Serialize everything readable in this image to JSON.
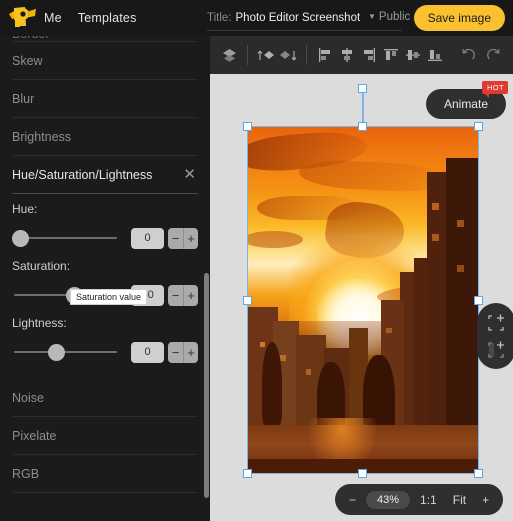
{
  "header": {
    "logo_icon": "logo-p-icon",
    "nav": [
      {
        "label": "Me"
      },
      {
        "label": "Templates"
      }
    ],
    "title_label": "Title:",
    "title_value": "Photo Editor Screenshot",
    "privacy_caret": "▼",
    "privacy_label": "Public",
    "save_label": "Save image"
  },
  "sidebar": {
    "clipped_item": "Border",
    "items": [
      {
        "label": "Skew"
      },
      {
        "label": "Blur"
      },
      {
        "label": "Brightness"
      }
    ],
    "active_panel": {
      "label": "Hue/Saturation/Lightness",
      "close_icon": "close-icon",
      "controls": [
        {
          "label": "Hue:",
          "value": "0",
          "thumb_pct": 0,
          "minus": "−",
          "plus": "+"
        },
        {
          "label": "Saturation:",
          "value": "60",
          "thumb_pct": 60,
          "minus": "−",
          "plus": "+"
        },
        {
          "label": "Lightness:",
          "value": "0",
          "thumb_pct": 40,
          "minus": "−",
          "plus": "+"
        }
      ]
    },
    "items_after": [
      {
        "label": "Noise"
      },
      {
        "label": "Pixelate"
      },
      {
        "label": "RGB"
      }
    ],
    "tooltip": "Saturation value"
  },
  "toolbar": {
    "icons": [
      {
        "name": "layers-icon"
      },
      {
        "name": "bring-forward-icon"
      },
      {
        "name": "send-backward-icon"
      },
      {
        "name": "align-left-icon"
      },
      {
        "name": "align-center-horizontal-icon"
      },
      {
        "name": "align-right-icon"
      },
      {
        "name": "align-top-icon"
      },
      {
        "name": "align-middle-vertical-icon"
      },
      {
        "name": "align-bottom-icon"
      },
      {
        "name": "undo-icon"
      },
      {
        "name": "redo-icon"
      }
    ]
  },
  "canvas": {
    "animate_label": "Animate",
    "hot_badge": "HOT",
    "image_alt": "Orange sunset over city skyline with silhouetted buildings",
    "frame_icons": [
      {
        "name": "add-frame-icon"
      },
      {
        "name": "add-frame-back-icon"
      }
    ],
    "zoom": {
      "minus": "−",
      "percent": "43%",
      "one_to_one": "1:1",
      "fit": "Fit",
      "plus": "+"
    }
  },
  "colors": {
    "accent": "#fbc02d",
    "hot": "#e03a30",
    "selection": "#5aa9e6",
    "canvas_bg": "#dcdcdc"
  }
}
